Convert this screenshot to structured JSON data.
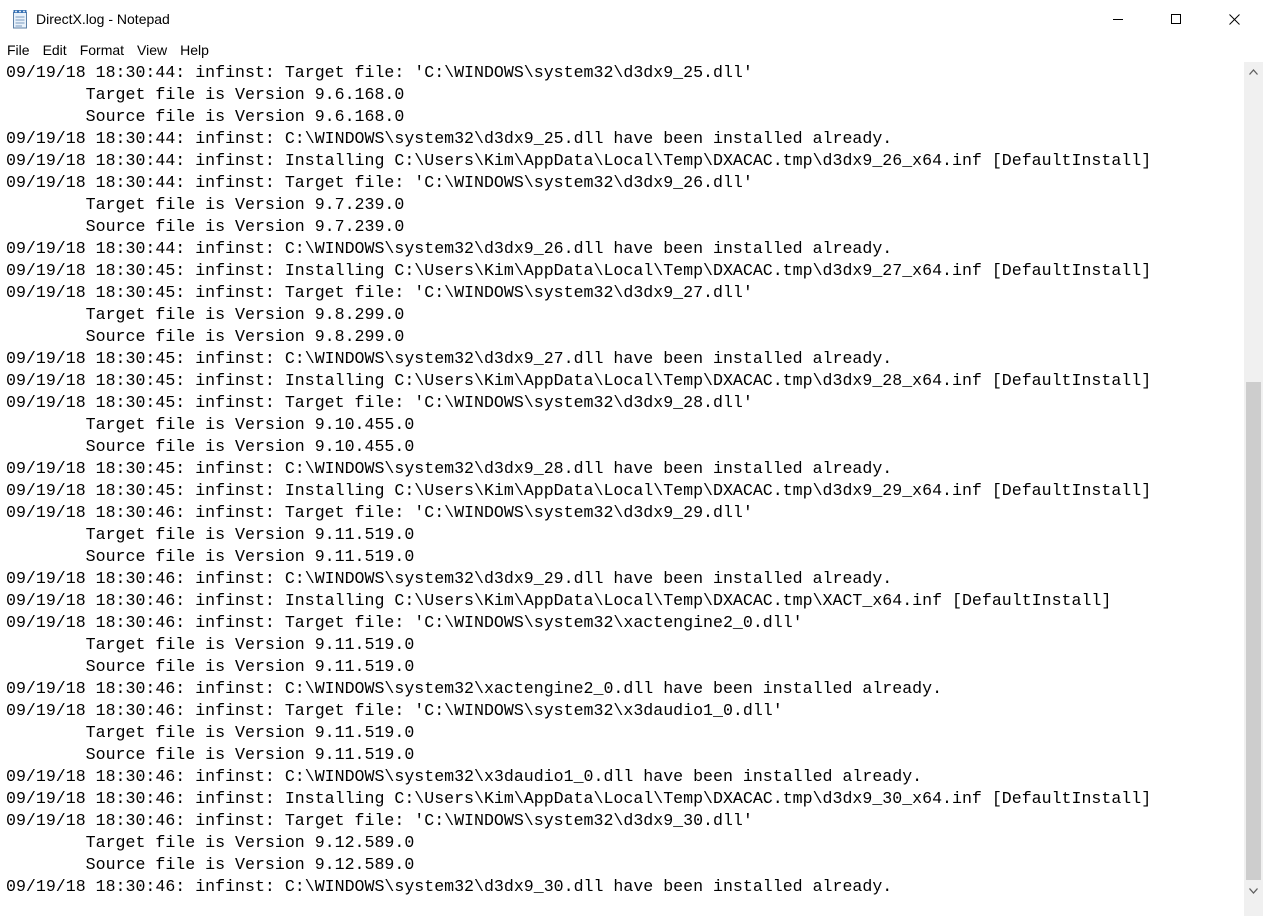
{
  "window": {
    "title": "DirectX.log - Notepad",
    "icons": {
      "app": "notepad-icon",
      "minimize": "minimize-icon",
      "maximize": "maximize-icon",
      "close": "close-icon"
    }
  },
  "menu": [
    "File",
    "Edit",
    "Format",
    "View",
    "Help"
  ],
  "lines": [
    "09/19/18 18:30:44: infinst: Target file: 'C:\\WINDOWS\\system32\\d3dx9_25.dll'",
    "        Target file is Version 9.6.168.0",
    "        Source file is Version 9.6.168.0",
    "09/19/18 18:30:44: infinst: C:\\WINDOWS\\system32\\d3dx9_25.dll have been installed already.",
    "09/19/18 18:30:44: infinst: Installing C:\\Users\\Kim\\AppData\\Local\\Temp\\DXACAC.tmp\\d3dx9_26_x64.inf [DefaultInstall]",
    "09/19/18 18:30:44: infinst: Target file: 'C:\\WINDOWS\\system32\\d3dx9_26.dll'",
    "        Target file is Version 9.7.239.0",
    "        Source file is Version 9.7.239.0",
    "09/19/18 18:30:44: infinst: C:\\WINDOWS\\system32\\d3dx9_26.dll have been installed already.",
    "09/19/18 18:30:45: infinst: Installing C:\\Users\\Kim\\AppData\\Local\\Temp\\DXACAC.tmp\\d3dx9_27_x64.inf [DefaultInstall]",
    "09/19/18 18:30:45: infinst: Target file: 'C:\\WINDOWS\\system32\\d3dx9_27.dll'",
    "        Target file is Version 9.8.299.0",
    "        Source file is Version 9.8.299.0",
    "09/19/18 18:30:45: infinst: C:\\WINDOWS\\system32\\d3dx9_27.dll have been installed already.",
    "09/19/18 18:30:45: infinst: Installing C:\\Users\\Kim\\AppData\\Local\\Temp\\DXACAC.tmp\\d3dx9_28_x64.inf [DefaultInstall]",
    "09/19/18 18:30:45: infinst: Target file: 'C:\\WINDOWS\\system32\\d3dx9_28.dll'",
    "        Target file is Version 9.10.455.0",
    "        Source file is Version 9.10.455.0",
    "09/19/18 18:30:45: infinst: C:\\WINDOWS\\system32\\d3dx9_28.dll have been installed already.",
    "09/19/18 18:30:45: infinst: Installing C:\\Users\\Kim\\AppData\\Local\\Temp\\DXACAC.tmp\\d3dx9_29_x64.inf [DefaultInstall]",
    "09/19/18 18:30:46: infinst: Target file: 'C:\\WINDOWS\\system32\\d3dx9_29.dll'",
    "        Target file is Version 9.11.519.0",
    "        Source file is Version 9.11.519.0",
    "09/19/18 18:30:46: infinst: C:\\WINDOWS\\system32\\d3dx9_29.dll have been installed already.",
    "09/19/18 18:30:46: infinst: Installing C:\\Users\\Kim\\AppData\\Local\\Temp\\DXACAC.tmp\\XACT_x64.inf [DefaultInstall]",
    "09/19/18 18:30:46: infinst: Target file: 'C:\\WINDOWS\\system32\\xactengine2_0.dll'",
    "        Target file is Version 9.11.519.0",
    "        Source file is Version 9.11.519.0",
    "09/19/18 18:30:46: infinst: C:\\WINDOWS\\system32\\xactengine2_0.dll have been installed already.",
    "09/19/18 18:30:46: infinst: Target file: 'C:\\WINDOWS\\system32\\x3daudio1_0.dll'",
    "        Target file is Version 9.11.519.0",
    "        Source file is Version 9.11.519.0",
    "09/19/18 18:30:46: infinst: C:\\WINDOWS\\system32\\x3daudio1_0.dll have been installed already.",
    "09/19/18 18:30:46: infinst: Installing C:\\Users\\Kim\\AppData\\Local\\Temp\\DXACAC.tmp\\d3dx9_30_x64.inf [DefaultInstall]",
    "09/19/18 18:30:46: infinst: Target file: 'C:\\WINDOWS\\system32\\d3dx9_30.dll'",
    "        Target file is Version 9.12.589.0",
    "        Source file is Version 9.12.589.0",
    "09/19/18 18:30:46: infinst: C:\\WINDOWS\\system32\\d3dx9_30.dll have been installed already."
  ]
}
